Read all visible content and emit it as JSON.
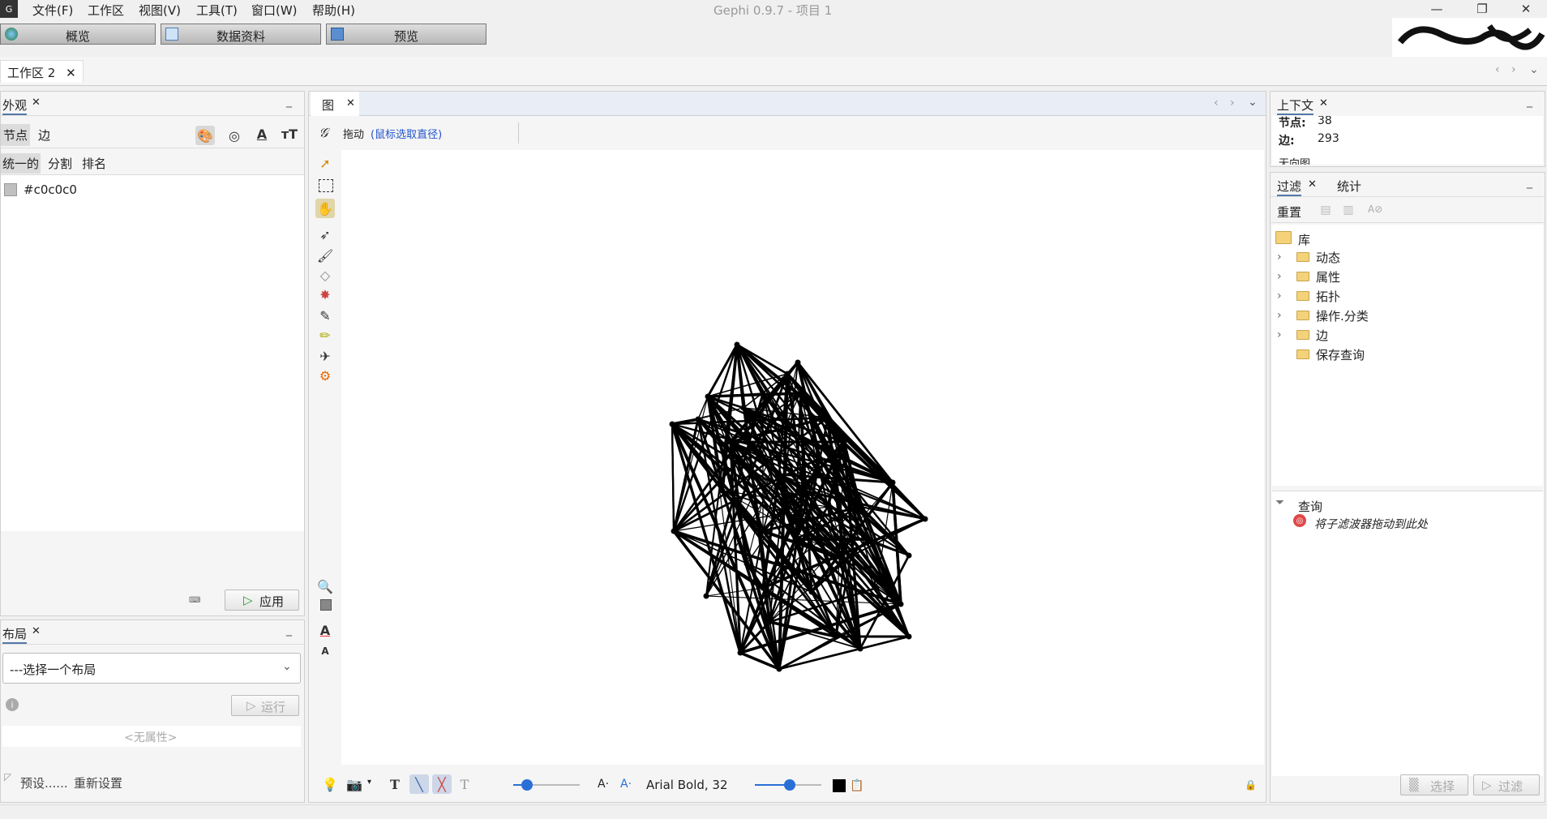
{
  "menubar": {
    "items": [
      "文件(F)",
      "工作区",
      "视图(V)",
      "工具(T)",
      "窗口(W)",
      "帮助(H)"
    ],
    "title": "Gephi 0.9.7 - 项目 1"
  },
  "modes": {
    "overview": "概览",
    "data_lab": "数据资料",
    "preview": "预览"
  },
  "workspace": {
    "tab_label": "工作区 2"
  },
  "appearance": {
    "tab": "外观",
    "subtabs": [
      "节点",
      "边"
    ],
    "modes": [
      "统一的",
      "分割",
      "排名"
    ],
    "color_value": "#c0c0c0",
    "apply_label": "应用"
  },
  "layout": {
    "tab": "布局",
    "select_placeholder": "---选择一个布局",
    "run_label": "运行",
    "no_props": "<无属性>",
    "presets_label": "预设......",
    "reset_label": "重新设置"
  },
  "graph": {
    "tab": "图",
    "tool_label": "拖动",
    "tool_hint": "(鼠标选取直径)",
    "font_label": "Arial Bold, 32"
  },
  "context": {
    "tab": "上下文",
    "nodes_label": "节点:",
    "nodes_value": "38",
    "edges_label": "边:",
    "edges_value": "293",
    "cut_text": "无向图"
  },
  "filters": {
    "tabs": [
      "过滤",
      "统计"
    ],
    "reset_label": "重置",
    "library": "库",
    "categories": [
      "动态",
      "属性",
      "拓扑",
      "操作.分类",
      "边"
    ],
    "saved": "保存查询",
    "query_label": "查询",
    "drop_hint": "将子滤波器拖动到此处",
    "select_btn": "选择",
    "filter_btn": "过滤"
  },
  "colors": {
    "node_color": "#c0c0c0",
    "accent": "#5577aa"
  }
}
